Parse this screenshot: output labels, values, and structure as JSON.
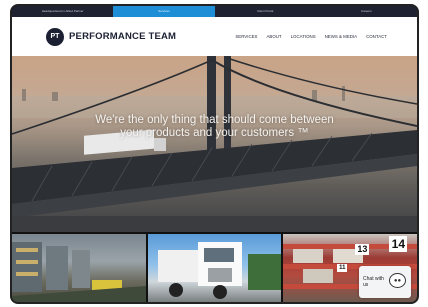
{
  "topbar": {
    "links": [
      "Headquartered in Allied Partner",
      "Services",
      "Client Portal",
      "Careers"
    ],
    "active_index": 1
  },
  "header": {
    "logo_initials": "PT",
    "brand": "PERFORMANCE TEAM",
    "nav": [
      "SERVICES",
      "ABOUT",
      "LOCATIONS",
      "NEWS & MEDIA",
      "CONTACT"
    ]
  },
  "hero": {
    "tagline_line1": "We're the only thing that should come between",
    "tagline_line2": "your products and your customers ™"
  },
  "thumbnails": {
    "numbers": [
      "13",
      "14",
      "11"
    ]
  },
  "chat": {
    "label": "Chat with us",
    "icon": "chat-bubble-icon"
  },
  "colors": {
    "nav_dark": "#1f2230",
    "accent_blue": "#1e8fd6",
    "brand_navy": "#1b2033"
  }
}
